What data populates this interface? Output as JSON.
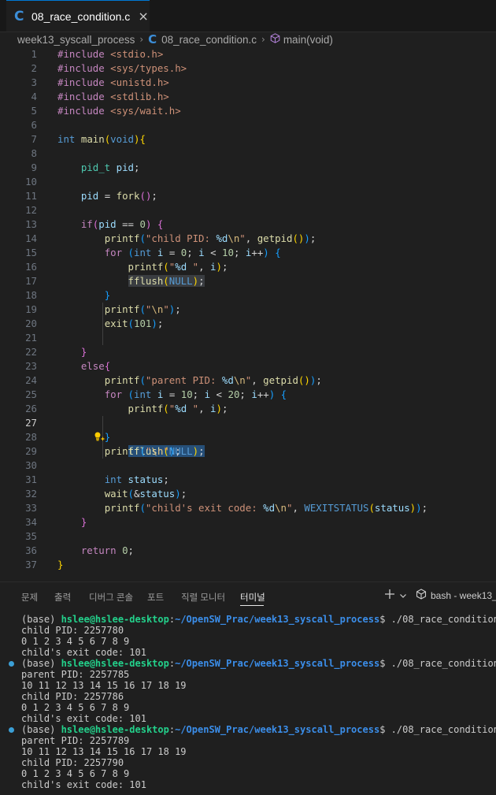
{
  "tab": {
    "icon": "c-language-icon",
    "title": "08_race_condition.c",
    "close": "×"
  },
  "breadcrumb": {
    "folder": "week13_syscall_process",
    "file": "08_race_condition.c",
    "symbol": "main(void)"
  },
  "editor": {
    "active_line": 27
  },
  "panel": {
    "tabs": [
      "문제",
      "출력",
      "디버그 콘솔",
      "포트",
      "직렬 모니터",
      "터미널"
    ],
    "active_tab": "터미널",
    "terminal_label": "bash - week13_"
  },
  "terminal": {
    "prompt_prefix": "(base) ",
    "user": "hslee@hslee-desktop",
    "path": "~/OpenSW_Prac/week13_syscall_process",
    "command": "./08_race_condition",
    "lines": [
      "child PID: 2257780",
      "0 1 2 3 4 5 6 7 8 9",
      "child's exit code: 101",
      "parent PID: 2257785",
      "10 11 12 13 14 15 16 17 18 19",
      "child PID: 2257786",
      "0 1 2 3 4 5 6 7 8 9",
      "child's exit code: 101",
      "parent PID: 2257789",
      "10 11 12 13 14 15 16 17 18 19",
      "child PID: 2257790",
      "0 1 2 3 4 5 6 7 8 9",
      "child's exit code: 101"
    ]
  }
}
